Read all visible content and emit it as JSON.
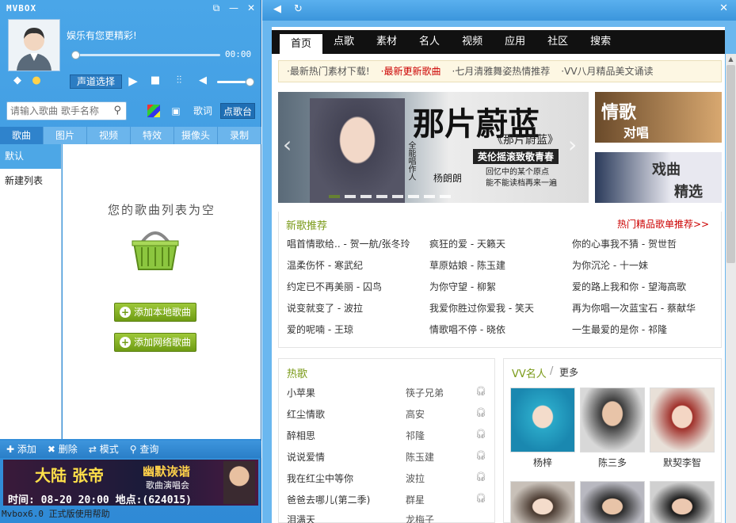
{
  "window": {
    "title": "MVBOX",
    "close": "✕",
    "minimize": "—",
    "restore": "⧉"
  },
  "player": {
    "slogan": "娱乐有您更精彩!",
    "time": "00:00",
    "progress": 0,
    "volume": 0.85,
    "channel_btn": "声道选择"
  },
  "search": {
    "placeholder": "请输入歌曲 歌手名称",
    "lyrics_btn": "歌词",
    "request_btn": "点歌台"
  },
  "tabs": [
    "歌曲",
    "图片",
    "视频",
    "特效",
    "摄像头",
    "录制"
  ],
  "playlists": [
    "默认",
    "新建列表"
  ],
  "empty": {
    "text": "您的歌曲列表为空",
    "add_local": "添加本地歌曲",
    "add_online": "添加网络歌曲"
  },
  "bottom": {
    "add": "添加",
    "delete": "删除",
    "mode": "模式",
    "query": "查询"
  },
  "ad": {
    "name": "大陆 张帝",
    "sub": "幽默诙谐",
    "sub2": "歌曲演唱会",
    "info": "时间: 08-20 20:00  地点:(624015)"
  },
  "status": "Mvbox6.0 正式版使用帮助",
  "nav": [
    "首页",
    "点歌",
    "素材",
    "名人",
    "视频",
    "应用",
    "社区",
    "搜索"
  ],
  "notice": [
    "·最新热门素材下载!",
    "·最新更新歌曲",
    "·七月清雅舞姿热情推荐",
    "·VV八月精品美文诵读"
  ],
  "banner": {
    "title": "那片蔚蓝",
    "song": "《那片蔚蓝》",
    "tag": "英伦摇滚致敬青春",
    "line1": "回忆中的某个原点",
    "line2": "能不能读档再来一遍",
    "artist": "杨朗朗",
    "role": "全能唱作人"
  },
  "promos": [
    {
      "text1": "情歌",
      "text2": "对唱"
    },
    {
      "text1": "戏曲",
      "text2": "精选"
    }
  ],
  "new_songs": {
    "title": "新歌推荐",
    "more": "热门精品歌单推荐>>",
    "items": [
      [
        "唱首情歌给.. - 贺一航/张冬玲",
        "疯狂的爱 - 天籁天",
        "你的心事我不猜 - 贺世哲"
      ],
      [
        "温柔伤怀 - 寒武纪",
        "草原姑娘 - 陈玉建",
        "为你沉沦 - 十一妹"
      ],
      [
        "约定已不再美丽 - 囚鸟",
        "为你守望 - 柳絮",
        "爱的路上我和你 - 望海高歌"
      ],
      [
        "说变就变了 - 波拉",
        "我爱你胜过你爱我 - 笑天",
        "再为你唱一次蓝宝石 - 蔡献华"
      ],
      [
        "爱的呢喃 - 王琼",
        "情歌唱不停 - 晓依",
        "一生最爱的是你 - 祁隆"
      ]
    ]
  },
  "hot": {
    "title": "热歌",
    "items": [
      {
        "title": "小苹果",
        "artist": "筷子兄弟"
      },
      {
        "title": "红尘情歌",
        "artist": "高安"
      },
      {
        "title": "醉相思",
        "artist": "祁隆"
      },
      {
        "title": "说说爱情",
        "artist": "陈玉建"
      },
      {
        "title": "我在红尘中等你",
        "artist": "波拉"
      },
      {
        "title": "爸爸去哪儿(第二季)",
        "artist": "群星"
      },
      {
        "title": "泪满天",
        "artist": "龙梅子"
      }
    ]
  },
  "vv": {
    "title": "VV名人",
    "sep": "/",
    "more": "更多",
    "people": [
      "杨梓",
      "陈三多",
      "默契李智"
    ]
  },
  "icons": {
    "search": "search-icon",
    "back": "back-arrow-icon",
    "refresh": "refresh-icon",
    "headphone": "headphone-icon"
  },
  "colors": {
    "accent": "#3b96dc",
    "green": "#7a9a18",
    "hot": "#cc0000"
  }
}
